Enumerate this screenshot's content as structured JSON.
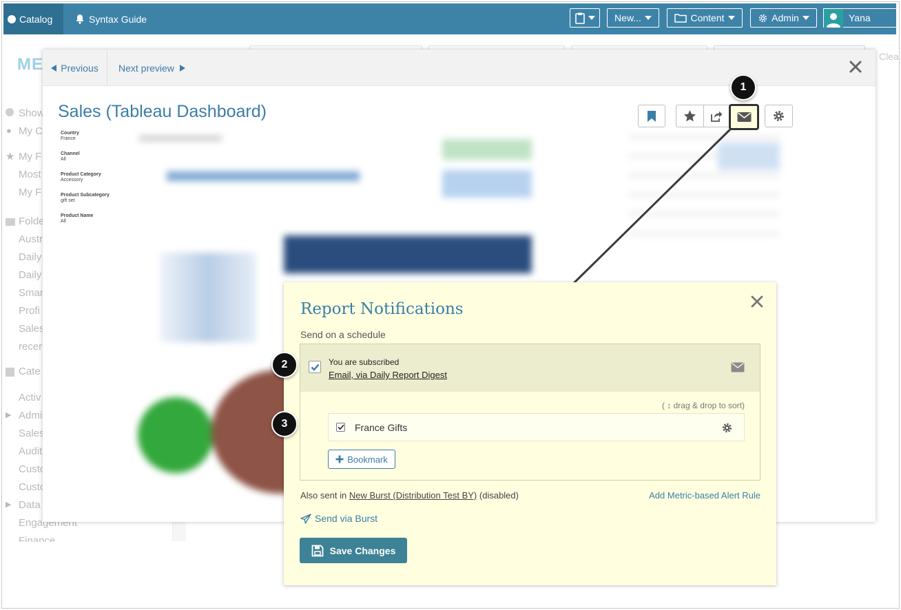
{
  "topnav": {
    "catalog_label": "Catalog",
    "syntax_label": "Syntax Guide",
    "new_label": "New...",
    "content_label": "Content",
    "admin_label": "Admin",
    "user_name": "Yana"
  },
  "background": {
    "logo_text": "ME",
    "clear_label": "Clea",
    "sidebar_items": [
      "Show",
      "My C",
      "My F",
      "Most",
      "My F",
      "Folde",
      "Austr",
      "Daily",
      "Daily",
      "Smar",
      "Profi",
      "Sales",
      "recer",
      "Cate",
      "Activ",
      "Admi",
      "Sales",
      "Audit",
      "Custo",
      "Custo",
      "Data",
      "Engagement",
      "Finance"
    ]
  },
  "modal": {
    "previous_label": "Previous",
    "next_label": "Next preview",
    "title": "Sales (Tableau Dashboard)",
    "filters": [
      {
        "label": "Country",
        "value": "France"
      },
      {
        "label": "Channel",
        "value": "All"
      },
      {
        "label": "Product Category",
        "value": "Accessory"
      },
      {
        "label": "Product Subcategory",
        "value": "gift set"
      },
      {
        "label": "Product Name",
        "value": "All"
      }
    ]
  },
  "callouts": [
    "1",
    "2",
    "3"
  ],
  "notifications": {
    "title": "Report Notifications",
    "subtitle": "Send on a schedule",
    "subscribed_text": "You are subscribed",
    "subscription_link": "Email, via Daily Report Digest",
    "drag_hint": "( ↕ drag & drop to sort)",
    "bookmark_name": "France Gifts",
    "bookmark_button_label": "Bookmark",
    "also_sent_prefix": "Also sent in",
    "burst_link": "New Burst (Distribution Test BY)",
    "disabled_suffix": "(disabled)",
    "add_alert_label": "Add Metric-based Alert Rule",
    "send_via_burst_label": "Send via Burst",
    "save_label": "Save Changes"
  },
  "colors": {
    "nav_bg": "#3d83a8",
    "nav_active": "#2e6f92",
    "accent": "#3b7ea6",
    "popup_bg": "#ffffe0",
    "save_bg": "#3d8296"
  },
  "icons": [
    "bell-icon",
    "clipboard-icon",
    "folder-icon",
    "gear-icon",
    "user-icon",
    "bookmark-icon",
    "star-icon",
    "share-icon",
    "envelope-icon",
    "close-icon",
    "check-icon",
    "plus-icon",
    "paper-plane-icon",
    "save-icon"
  ]
}
